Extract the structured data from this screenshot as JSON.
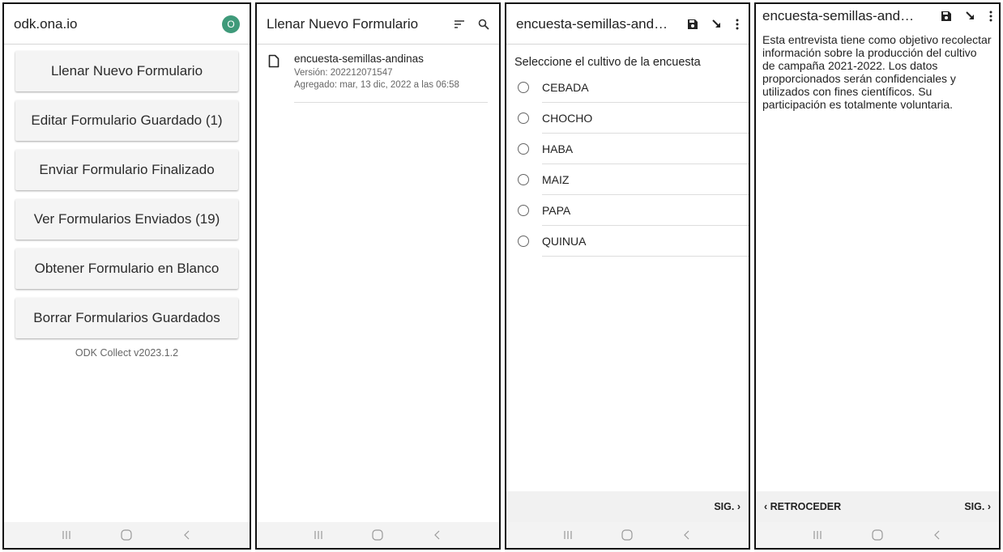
{
  "panel1": {
    "title": "odk.ona.io",
    "badge": "O",
    "buttons": [
      "Llenar Nuevo Formulario",
      "Editar Formulario Guardado (1)",
      "Enviar Formulario Finalizado",
      "Ver Formularios Enviados (19)",
      "Obtener Formulario en Blanco",
      "Borrar Formularios Guardados"
    ],
    "version": "ODK Collect v2023.1.2"
  },
  "panel2": {
    "title": "Llenar Nuevo Formulario",
    "icons": [
      "sort-icon",
      "search-icon"
    ],
    "form": {
      "name": "encuesta-semillas-andinas",
      "version": "Versión: 202212071547",
      "added": "Agregado: mar, 13 dic, 2022 a las 06:58"
    }
  },
  "panel3": {
    "title": "encuesta-semillas-and…",
    "icons": [
      "save-icon",
      "jump-icon",
      "more-vert-icon"
    ],
    "question": "Seleccione el cultivo de la encuesta",
    "options": [
      "CEBADA",
      "CHOCHO",
      "HABA",
      "MAIZ",
      "PAPA",
      "QUINUA"
    ],
    "next": "SIG. ›"
  },
  "panel4": {
    "title": "encuesta-semillas-and…",
    "icons": [
      "save-icon",
      "jump-icon",
      "more-vert-icon"
    ],
    "intro": "Esta entrevista tiene como objetivo recolectar información sobre la producción del cultivo de campaña 2021-2022. Los datos proporcionados serán confidenciales y utilizados con fines científicos. Su participación es totalmente voluntaria.",
    "back": "‹ RETROCEDER",
    "next": "SIG. ›"
  },
  "system_nav": [
    "recents-icon",
    "home-icon",
    "back-icon"
  ],
  "colors": {
    "badge": "#3f9a7a",
    "button_bg": "#f4f4f4",
    "nav_bg": "#f1f1f1"
  }
}
